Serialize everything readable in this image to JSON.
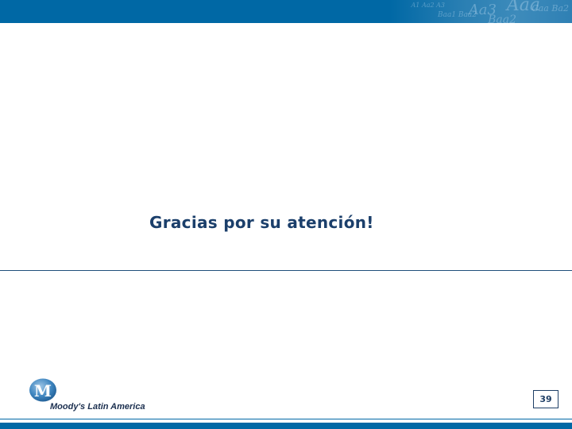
{
  "slide": {
    "title": "Gracias por su atención!",
    "page_number": "39"
  },
  "logo": {
    "mark_letter": "M",
    "company_name": "Moody's Latin America",
    "icon": "moodys-logo-icon"
  },
  "colors": {
    "brand_blue": "#0068a5",
    "title_navy": "#1b3f6b",
    "divider": "#1f4f7a"
  }
}
